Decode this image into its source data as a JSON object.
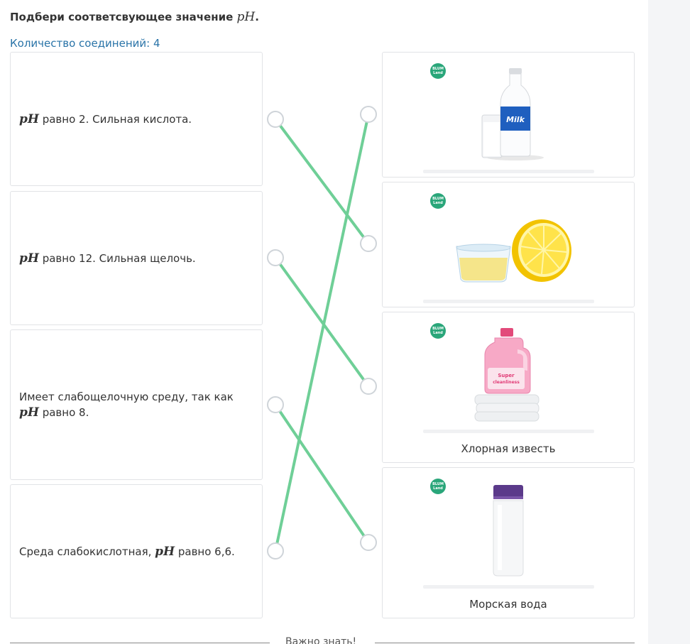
{
  "task": {
    "title_prefix": "Подбери соответсвующее значение ",
    "title_math": "pH",
    "title_suffix": ".",
    "count_text": "Количество соединений: 4"
  },
  "left_items": [
    {
      "prefix": "",
      "math": "pH",
      "suffix": " равно 2. Сильная кислота."
    },
    {
      "prefix": "",
      "math": "pH",
      "suffix": " равно 12. Сильная щелочь."
    },
    {
      "prefix": "Имеет слабощелочную среду, так как ",
      "math": "pH",
      "suffix": " равно 8."
    },
    {
      "prefix": "Среда слабокислотная, ",
      "math": "pH",
      "suffix": " равно 6,6."
    }
  ],
  "right_items": [
    {
      "image": "milk-bottle-and-glass",
      "caption": ""
    },
    {
      "image": "lemon-and-juice-bowl",
      "caption": ""
    },
    {
      "image": "bleach-bottle-on-towels",
      "caption": "Хлорная известь"
    },
    {
      "image": "water-bottle",
      "caption": "Морская вода"
    }
  ],
  "badge_text": "BLUM Land",
  "connections": [
    {
      "from": 0,
      "to": 1
    },
    {
      "from": 1,
      "to": 2
    },
    {
      "from": 2,
      "to": 3
    },
    {
      "from": 3,
      "to": 0
    }
  ],
  "connection_color": "#6fcf97",
  "footer": {
    "text": "Важно знать!"
  }
}
